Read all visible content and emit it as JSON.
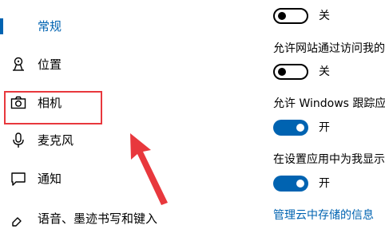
{
  "sidebar": {
    "items": [
      {
        "label": "常规",
        "icon": "accent-bar",
        "active": true
      },
      {
        "label": "位置",
        "icon": "location-icon",
        "active": false
      },
      {
        "label": "相机",
        "icon": "camera-icon",
        "active": false
      },
      {
        "label": "麦克风",
        "icon": "microphone-icon",
        "active": false
      },
      {
        "label": "通知",
        "icon": "notification-icon",
        "active": false
      },
      {
        "label": "语音、墨迹书写和键入",
        "icon": "speech-icon",
        "active": false
      }
    ]
  },
  "settings": {
    "items": [
      {
        "description": "",
        "toggle_state": "关",
        "on": false
      },
      {
        "description": "允许网站通过访问我的",
        "toggle_state": "关",
        "on": false
      },
      {
        "description": "允许 Windows 跟踪应",
        "toggle_state": "开",
        "on": true
      },
      {
        "description": "在设置应用中为我显示",
        "toggle_state": "开",
        "on": true
      }
    ],
    "link": "管理云中存储的信息"
  },
  "annotation": {
    "highlight_color": "#e8383d",
    "arrow_color": "#e8383d"
  },
  "colors": {
    "accent": "#0063b1",
    "text": "#000000",
    "background": "#ffffff"
  }
}
